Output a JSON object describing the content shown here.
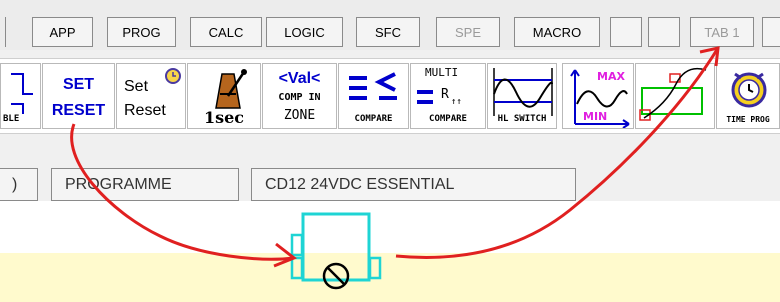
{
  "category_tabs": [
    {
      "label": "APP",
      "enabled": true
    },
    {
      "label": "PROG",
      "enabled": true
    },
    {
      "label": "CALC",
      "enabled": true
    },
    {
      "label": "LOGIC",
      "enabled": true
    },
    {
      "label": "SFC",
      "enabled": true
    },
    {
      "label": "SPE",
      "enabled": false
    },
    {
      "label": "MACRO",
      "enabled": true
    },
    {
      "label": "",
      "enabled": true
    },
    {
      "label": "",
      "enabled": true
    },
    {
      "label": "TAB 1",
      "enabled": false
    }
  ],
  "function_blocks": {
    "fb0_label": "BLE",
    "set_reset_top": "SET",
    "set_reset_bottom": "RESET",
    "set_reset2_top": "Set",
    "set_reset2_bottom": "Reset",
    "timer_label": "1sec",
    "comp_in_zone_top": "<Val<",
    "comp_in_zone_mid": "COMP IN",
    "comp_in_zone_bottom": "ZONE",
    "compare_label": "COMPARE",
    "multi_top": "MULTI",
    "multi_label": "COMPARE",
    "hl_switch_label": "HL SWITCH",
    "max": "MAX",
    "min": "MIN",
    "time_prog_label": "TIME PROG"
  },
  "program_tabs": [
    {
      "label": ")"
    },
    {
      "label": "PROGRAMME"
    },
    {
      "label": "CD12  24VDC ESSENTIAL"
    }
  ],
  "colors": {
    "annotation_arrow": "#e02020",
    "block_outline": "#1ed4d4",
    "blue_text": "#0000cc",
    "canvas_band": "#fffacd"
  }
}
